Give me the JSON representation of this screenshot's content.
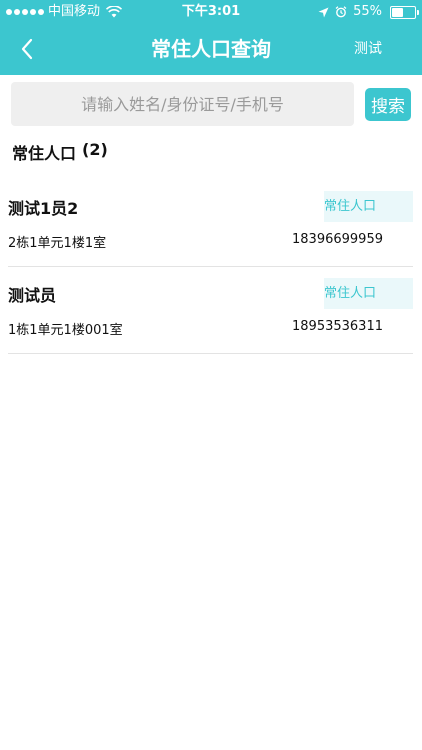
{
  "status_bar": {
    "carrier": "中国移动",
    "time": "下午3:01",
    "battery_percent": "55%",
    "battery_level": 0.55
  },
  "nav": {
    "title": "常住人口查询",
    "right_label": "测试",
    "back_icon": "chevron-left-icon"
  },
  "search": {
    "placeholder": "请输入姓名/身份证号/手机号",
    "value": "",
    "button_label": "搜索"
  },
  "section": {
    "title": "常住人口",
    "count": "(2)"
  },
  "residents": [
    {
      "name": "测试1员2",
      "badge": "常住人口",
      "address": "2栋1单元1楼1室",
      "phone": "18396699959"
    },
    {
      "name": "测试员",
      "badge": "常住人口",
      "address": "1栋1单元1楼001室",
      "phone": "18953536311"
    }
  ],
  "colors": {
    "accent": "#3cc6cf",
    "badge_bg": "#eaf8fa",
    "input_bg": "#efefef"
  }
}
